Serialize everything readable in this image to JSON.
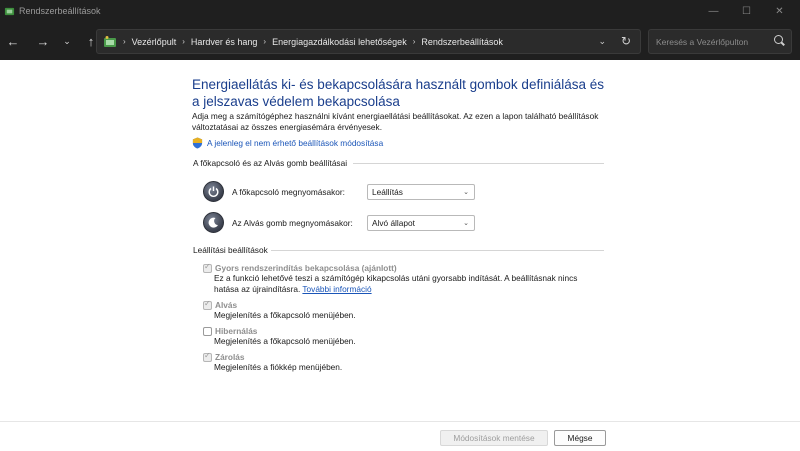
{
  "window": {
    "title": "Rendszerbeállítások"
  },
  "breadcrumb": [
    "Vezérlőpult",
    "Hardver és hang",
    "Energiagazdálkodási lehetőségek",
    "Rendszerbeállítások"
  ],
  "search": {
    "placeholder": "Keresés a Vezérlőpulton"
  },
  "page": {
    "heading": "Energiaellátás ki- és bekapcsolására használt gombok definiálása és a jelszavas védelem bekapcsolása",
    "intro": "Adja meg a számítógéphez használni kívánt energiaellátási beállításokat. Az ezen a lapon található beállítások változtatásai az összes energiasémára érvényesek.",
    "admin_link": "A jelenleg el nem érhető beállítások módosítása"
  },
  "buttons_group": {
    "title": "A főkapcsoló és az Alvás gomb beállításai",
    "rows": [
      {
        "label": "A főkapcsoló megnyomásakor:",
        "value": "Leállítás",
        "icon": "power-icon"
      },
      {
        "label": "Az Alvás gomb megnyomásakor:",
        "value": "Alvó állapot",
        "icon": "sleep-icon"
      }
    ]
  },
  "shutdown_group": {
    "title": "Leállítási beállítások",
    "options": [
      {
        "title": "Gyors rendszerindítás bekapcsolása (ajánlott)",
        "checked": true,
        "desc_line1": "Ez a funkció lehetővé teszi a számítógép kikapcsolás utáni gyorsabb indítását. A beállításnak nincs",
        "desc_line2": "hatása az újraindításra.",
        "link": "További információ"
      },
      {
        "title": "Alvás",
        "checked": true,
        "desc": "Megjelenítés a főkapcsoló menüjében."
      },
      {
        "title": "Hibernálás",
        "checked": false,
        "desc": "Megjelenítés a főkapcsoló menüjében."
      },
      {
        "title": "Zárolás",
        "checked": true,
        "desc": "Megjelenítés a fiókkép menüjében."
      }
    ]
  },
  "footer": {
    "save_label": "Módosítások mentése",
    "cancel_label": "Mégse"
  }
}
